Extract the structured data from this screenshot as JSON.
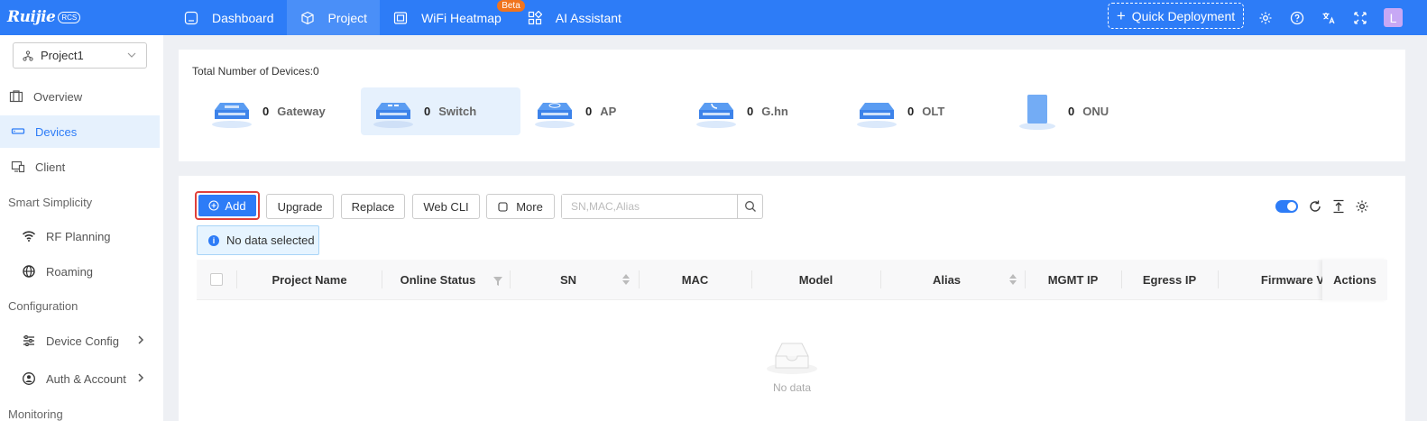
{
  "brand": {
    "logo_text": "Ruijie",
    "logo_badge": "RCS"
  },
  "nav": {
    "items": [
      {
        "label": "Dashboard",
        "icon": "dashboard-icon"
      },
      {
        "label": "Project",
        "icon": "cube-icon",
        "active": true
      },
      {
        "label": "WiFi Heatmap",
        "icon": "heatmap-icon",
        "badge": "Beta"
      },
      {
        "label": "AI Assistant",
        "icon": "grid-icon"
      }
    ],
    "quick_deployment": "Quick Deployment",
    "avatar": "L"
  },
  "sidebar": {
    "project": "Project1",
    "items": {
      "overview": "Overview",
      "devices": "Devices",
      "client": "Client",
      "smart_simplicity": "Smart Simplicity",
      "rf_planning": "RF Planning",
      "roaming": "Roaming",
      "configuration": "Configuration",
      "device_config": "Device Config",
      "auth_account": "Auth & Account",
      "monitoring": "Monitoring"
    }
  },
  "devices": {
    "total_label": "Total Number of Devices:0",
    "types": [
      {
        "count": "0",
        "label": "Gateway"
      },
      {
        "count": "0",
        "label": "Switch",
        "active": true
      },
      {
        "count": "0",
        "label": "AP"
      },
      {
        "count": "0",
        "label": "G.hn"
      },
      {
        "count": "0",
        "label": "OLT"
      },
      {
        "count": "0",
        "label": "ONU"
      }
    ]
  },
  "toolbar": {
    "add": "Add",
    "upgrade": "Upgrade",
    "replace": "Replace",
    "web_cli": "Web CLI",
    "more": "More",
    "search_placeholder": "SN,MAC,Alias",
    "toggle_on": true
  },
  "selection": {
    "text": "No data selected"
  },
  "table": {
    "columns": [
      "Project Name",
      "Online Status",
      "SN",
      "MAC",
      "Model",
      "Alias",
      "MGMT IP",
      "Egress IP",
      "Firmware V",
      "Actions"
    ],
    "empty_text": "No data"
  },
  "colors": {
    "primary": "#2d7cf7",
    "beta": "#f0741e",
    "highlight": "#e0403a"
  }
}
